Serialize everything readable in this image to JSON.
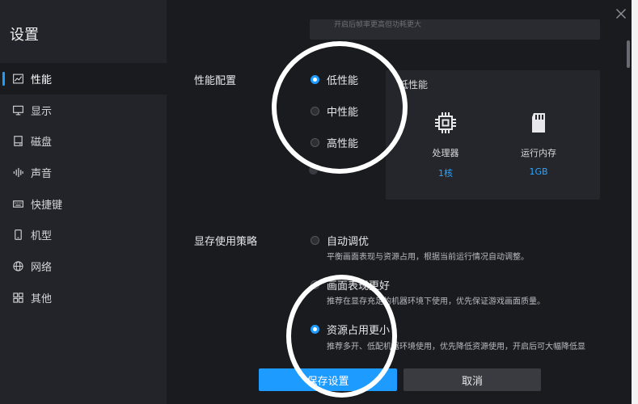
{
  "title": "设置",
  "sidebar": {
    "items": [
      {
        "label": "性能",
        "icon": "chart-line-icon"
      },
      {
        "label": "显示",
        "icon": "monitor-icon"
      },
      {
        "label": "磁盘",
        "icon": "disk-icon"
      },
      {
        "label": "声音",
        "icon": "sound-wave-icon"
      },
      {
        "label": "快捷键",
        "icon": "keyboard-icon"
      },
      {
        "label": "机型",
        "icon": "phone-icon"
      },
      {
        "label": "网络",
        "icon": "globe-icon"
      },
      {
        "label": "其他",
        "icon": "grid-icon"
      }
    ],
    "active_index": 0
  },
  "top_strip_text": "开启后帧率更高但功耗更大",
  "performance": {
    "label": "性能配置",
    "options": [
      "低性能",
      "中性能",
      "高性能"
    ],
    "selected_index": 0,
    "panel": {
      "title": "低性能",
      "cpu_label": "处理器",
      "cpu_value": "1核",
      "ram_label": "运行内存",
      "ram_value": "1GB"
    }
  },
  "memory": {
    "label": "显存使用策略",
    "options": [
      {
        "label": "自动调优",
        "desc": "平衡画面表现与资源占用，根据当前运行情况自动调整。"
      },
      {
        "label": "画面表现更好",
        "desc": "推荐在显存充足的机器环境下使用，优先保证游戏画面质量。"
      },
      {
        "label": "资源占用更小",
        "desc": "推荐多开、低配机器环境使用，优先降低资源使用，开启后可大幅降低显"
      }
    ],
    "selected_index": 2
  },
  "buttons": {
    "save": "保存设置",
    "cancel": "取消"
  },
  "colors": {
    "accent": "#1e9bff",
    "background": "#1a1b1f",
    "sidebar": "#232429"
  }
}
